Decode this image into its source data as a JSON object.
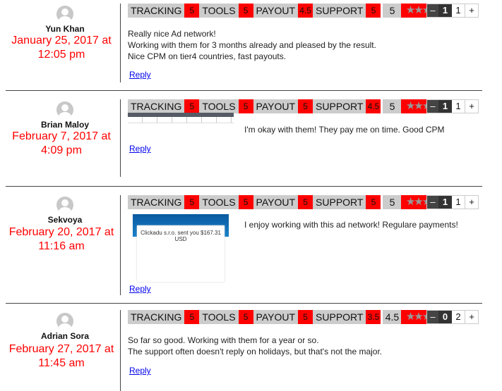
{
  "colors": {
    "rating_value_bg": "#ff0000",
    "label_bg": "#cccccc",
    "date": "#ff0000",
    "link": "#0000ee"
  },
  "rating_labels": {
    "tracking": "TRACKING",
    "tools": "TOOLS",
    "payout": "PAYOUT",
    "support": "SUPPORT"
  },
  "reply_label": "Reply",
  "vote": {
    "minus": "–",
    "plus": "+"
  },
  "comments": [
    {
      "author": "Yun Khan",
      "date": "January 25, 2017 at 12:05 pm",
      "ratings": {
        "tracking": "5",
        "tools": "5",
        "payout": "4.5",
        "support": "5"
      },
      "average": "5",
      "stars": 5,
      "vote_score": "1",
      "vote_total": "1",
      "lines": [
        "Really nice Ad network!",
        "Working with them for 3 months already and pleased by the result.",
        "Nice CPM on tier4 countries, fast payouts."
      ]
    },
    {
      "author": "Brian Maloy",
      "date": "February 7, 2017 at 4:09 pm",
      "ratings": {
        "tracking": "5",
        "tools": "5",
        "payout": "5",
        "support": "4.5"
      },
      "average": "5",
      "stars": 5,
      "vote_score": "1",
      "vote_total": "1",
      "lines": [
        "I'm okay with them! They pay me on time. Good CPM"
      ]
    },
    {
      "author": "Sekvoya",
      "date": "February 20, 2017 at 11:16 am",
      "ratings": {
        "tracking": "5",
        "tools": "5",
        "payout": "5",
        "support": "5"
      },
      "average": "5",
      "stars": 5,
      "vote_score": "1",
      "vote_total": "1",
      "lines": [
        "I enjoy working with this ad network! Regulare payments!"
      ],
      "image_caption": "Clickadu s.r.o. sent you $167.31 USD"
    },
    {
      "author": "Adrian Sora",
      "date": "February 27, 2017 at 11:45 am",
      "ratings": {
        "tracking": "5",
        "tools": "5",
        "payout": "5",
        "support": "3.5"
      },
      "average": "4.5",
      "stars": 4.5,
      "vote_score": "0",
      "vote_total": "2",
      "lines": [
        "So far so good. Working with them for a year or so.",
        "The support often doesn't reply on holidays, but that's not the major."
      ]
    }
  ]
}
